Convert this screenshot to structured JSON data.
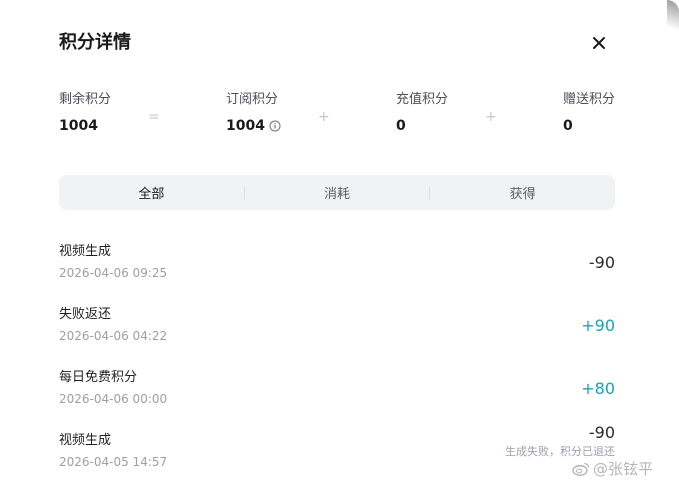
{
  "dialog": {
    "title": "积分详情"
  },
  "summary": {
    "remaining": {
      "label": "剩余积分",
      "value": "1004"
    },
    "subscription": {
      "label": "订阅积分",
      "value": "1004"
    },
    "recharge": {
      "label": "充值积分",
      "value": "0"
    },
    "gift": {
      "label": "赠送积分",
      "value": "0"
    },
    "equals": "=",
    "plus": "+"
  },
  "tabs": [
    {
      "label": "全部",
      "active": true
    },
    {
      "label": "消耗",
      "active": false
    },
    {
      "label": "获得",
      "active": false
    }
  ],
  "records": [
    {
      "name": "视频生成",
      "time": "2026-04-06 09:25",
      "amount": "-90",
      "type": "negative",
      "note": ""
    },
    {
      "name": "失败返还",
      "time": "2026-04-06 04:22",
      "amount": "+90",
      "type": "positive",
      "note": ""
    },
    {
      "name": "每日免费积分",
      "time": "2026-04-06 00:00",
      "amount": "+80",
      "type": "positive",
      "note": ""
    },
    {
      "name": "视频生成",
      "time": "2026-04-05 14:57",
      "amount": "-90",
      "type": "negative",
      "note": "生成失败，积分已退还"
    }
  ],
  "watermark": {
    "text": "@张铉平",
    "icon": "weibo-logo-icon"
  },
  "icons": {
    "close": "close-icon",
    "info": "info-icon"
  },
  "colors": {
    "positive": "#1aa3b3",
    "negative": "#2a2a2a",
    "tabs_bg": "#f1f2f4"
  }
}
